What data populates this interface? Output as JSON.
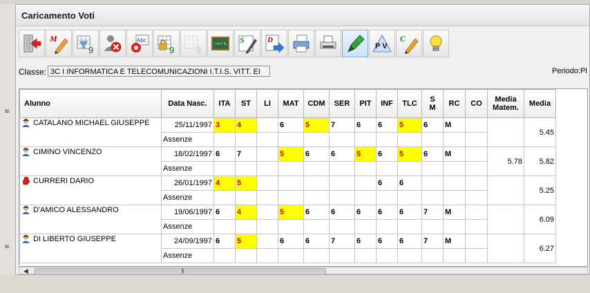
{
  "window": {
    "title": "Caricamento Voti"
  },
  "toolbar": {
    "buttons": [
      {
        "icon": "exit-icon"
      },
      {
        "icon": "pencil-m-icon",
        "letter": "M"
      },
      {
        "icon": "filter-grid-icon",
        "number": "9"
      },
      {
        "icon": "delete-user-icon"
      },
      {
        "icon": "spellcheck-icon",
        "text": "Abc"
      },
      {
        "icon": "lock-grid-icon",
        "number": "9"
      },
      {
        "icon": "grid-disabled-icon",
        "number": "9"
      },
      {
        "icon": "chalkboard-icon"
      },
      {
        "icon": "pencil-s-icon",
        "letter": "S"
      },
      {
        "icon": "document-d-icon",
        "letter": "D"
      },
      {
        "icon": "printer-icon"
      },
      {
        "icon": "print-preview-icon"
      },
      {
        "icon": "green-pen-icon"
      },
      {
        "icon": "pv-icon",
        "text": "P V"
      },
      {
        "icon": "pencil-c-icon",
        "letter": "C"
      },
      {
        "icon": "lightbulb-icon"
      }
    ]
  },
  "classe": {
    "label": "Classe:",
    "value": "3C I INFORMATICA E TELECOMUNICAZIONI I.T.I.S. VITT. EI"
  },
  "periodo": {
    "label": "Periodo:Pl"
  },
  "table": {
    "headers": {
      "alunno": "Alunno",
      "data": "Data Nasc.",
      "subjects": [
        "ITA",
        "ST",
        "LI",
        "MAT",
        "CDM",
        "SER",
        "PIT",
        "INF",
        "TLC",
        "S M",
        "RC",
        "CO"
      ],
      "media_matem": "Media Matem.",
      "media": "Media"
    },
    "assenze_label": "Assenze",
    "rows": [
      {
        "name": "CATALANO MICHAEL GIUSEPPE",
        "date": "25/11/1997",
        "icon": "student-icon",
        "votes": [
          "3",
          "4",
          "",
          "6",
          "5",
          "7",
          "6",
          "6",
          "5",
          "6",
          "M",
          ""
        ],
        "low": [
          true,
          true,
          false,
          false,
          true,
          false,
          false,
          false,
          true,
          false,
          false,
          false
        ],
        "media_matem": "",
        "media": "5.45"
      },
      {
        "name": "CIMINO VINCENZO",
        "date": "18/02/1997",
        "icon": "student-icon",
        "votes": [
          "6",
          "7",
          "",
          "5",
          "6",
          "6",
          "5",
          "6",
          "5",
          "6",
          "M",
          ""
        ],
        "low": [
          false,
          false,
          false,
          true,
          false,
          false,
          true,
          false,
          true,
          false,
          false,
          false
        ],
        "media_matem": "5.78",
        "media": "5.82"
      },
      {
        "name": "CURRERI DARIO",
        "date": "26/01/1997",
        "icon": "hand-stop-icon",
        "votes": [
          "4",
          "5",
          "",
          "",
          "",
          "",
          "",
          "6",
          "6",
          "",
          "",
          ""
        ],
        "low": [
          true,
          true,
          false,
          false,
          false,
          false,
          false,
          false,
          false,
          false,
          false,
          false
        ],
        "media_matem": "",
        "media": "5.25"
      },
      {
        "name": "D'AMICO ALESSANDRO",
        "date": "19/06/1997",
        "icon": "student-icon",
        "votes": [
          "6",
          "4",
          "",
          "5",
          "6",
          "6",
          "6",
          "6",
          "6",
          "7",
          "M",
          ""
        ],
        "low": [
          false,
          true,
          false,
          true,
          false,
          false,
          false,
          false,
          false,
          false,
          false,
          false
        ],
        "media_matem": "",
        "media": "6.09"
      },
      {
        "name": "DI LIBERTO GIUSEPPE",
        "date": "24/09/1997",
        "icon": "student-icon",
        "votes": [
          "6",
          "5",
          "",
          "6",
          "6",
          "7",
          "6",
          "6",
          "6",
          "7",
          "M",
          ""
        ],
        "low": [
          false,
          true,
          false,
          false,
          false,
          false,
          false,
          false,
          false,
          false,
          false,
          false
        ],
        "media_matem": "",
        "media": "6.27"
      }
    ]
  },
  "colors": {
    "low_vote_bg": "#ffff00",
    "low_vote_text": "#e00000"
  }
}
